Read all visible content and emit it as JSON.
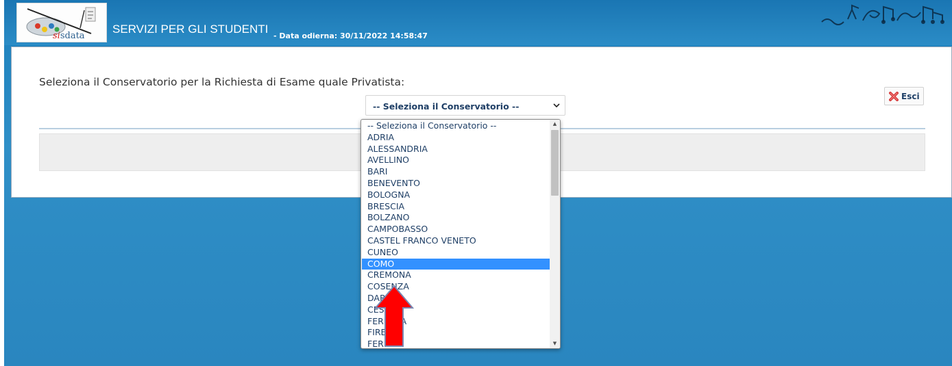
{
  "header": {
    "logo_brand_s": "s",
    "logo_brand_i": "i",
    "logo_brand_rest": "sdata",
    "title": "SERVIZI PER GLI STUDENTI",
    "date_text": "- Data odierna: 30/11/2022 14:58:47"
  },
  "main": {
    "prompt_label": "Seleziona il Conservatorio per la Richiesta di Esame quale Privatista:",
    "select_value": "-- Seleziona il Conservatorio --",
    "exit_label": "Esci"
  },
  "dropdown": {
    "options": [
      "-- Seleziona il Conservatorio --",
      "ADRIA",
      "ALESSANDRIA",
      "AVELLINO",
      "BARI",
      "BENEVENTO",
      "BOLOGNA",
      "BRESCIA",
      "BOLZANO",
      "CAMPOBASSO",
      "CASTEL FRANCO VENETO",
      "CUNEO",
      "COMO",
      "CREMONA",
      "COSENZA",
      "DARFO",
      "CESENA",
      "FERRARA",
      "FIRENZE",
      "FERMO"
    ],
    "highlighted_option": "COMO"
  },
  "colors": {
    "accent": "#3391ff",
    "header_blue": "#1a76b3",
    "arrow_red": "#ff0000",
    "text_navy": "#1f3f66"
  },
  "icons": [
    "logo-image",
    "music-notes-decoration",
    "chevron-down-icon",
    "close-x-icon",
    "red-arrow-annotation"
  ]
}
